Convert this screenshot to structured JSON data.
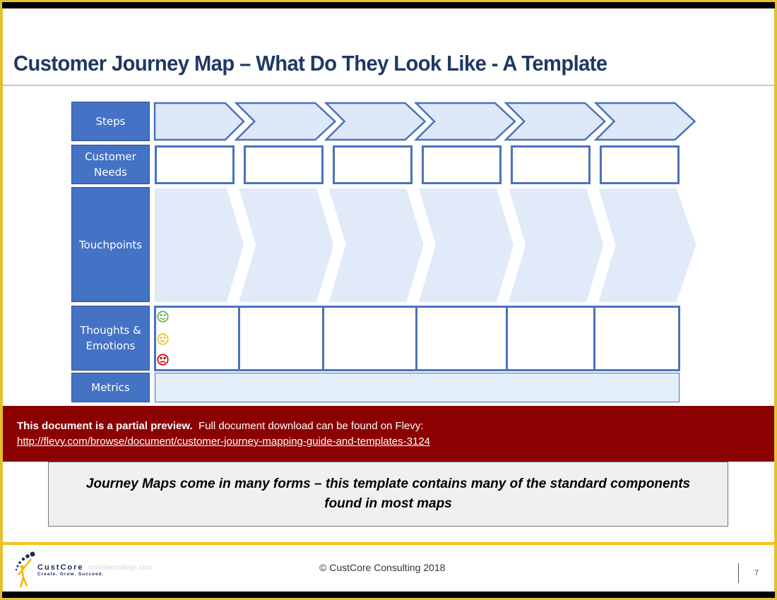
{
  "slide": {
    "title": "Customer Journey Map – What Do They Look Like - A Template",
    "page_number": "7",
    "copyright": "© CustCore Consulting 2018"
  },
  "journey_map": {
    "row_labels": {
      "steps": "Steps",
      "customer_needs": "Customer Needs",
      "touchpoints": "Touchpoints",
      "thoughts_emotions": "Thoughts & Emotions",
      "metrics": "Metrics"
    },
    "stage_count": 6,
    "emotions": [
      {
        "name": "happy",
        "color": "#6aa84f"
      },
      {
        "name": "neutral",
        "color": "#e6c229"
      },
      {
        "name": "sad",
        "color": "#cc0000"
      }
    ],
    "colors": {
      "label_fill": "#4472c4",
      "chevron_fill": "#dde8f8",
      "chevron_stroke": "#4a72bb",
      "touchpoint_fill": "#e0eaf9",
      "metrics_fill": "#e3eefb"
    }
  },
  "preview_banner": {
    "bold_text": "This document is a partial preview.",
    "text": "Full document download can be found on Flevy:",
    "link": "http://flevy.com/browse/document/customer-journey-mapping-guide-and-templates-3124",
    "color": "#8b0000"
  },
  "note": {
    "text": "Journey Maps come in many forms – this template contains many of the standard components found in most maps"
  },
  "logo": {
    "name": "CustCore",
    "tagline": "Create. Grow. Succeed.",
    "watermark": "christiancollege.com"
  }
}
